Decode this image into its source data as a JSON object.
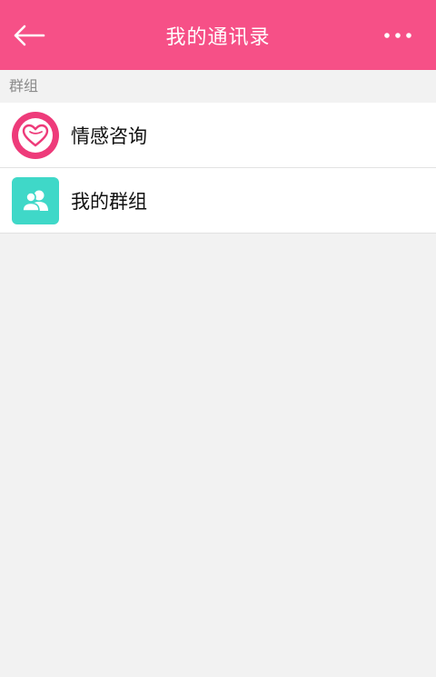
{
  "header": {
    "title": "我的通讯录",
    "back_icon": "arrow-left-icon",
    "more_icon": "more-dots-icon",
    "bg_color": "#f65087"
  },
  "section": {
    "title": "群组"
  },
  "items": [
    {
      "label": "情感咨询",
      "icon": "heart-icon",
      "icon_color": "#ee3b7a"
    },
    {
      "label": "我的群组",
      "icon": "group-icon",
      "icon_color": "#3fd8c8"
    }
  ]
}
